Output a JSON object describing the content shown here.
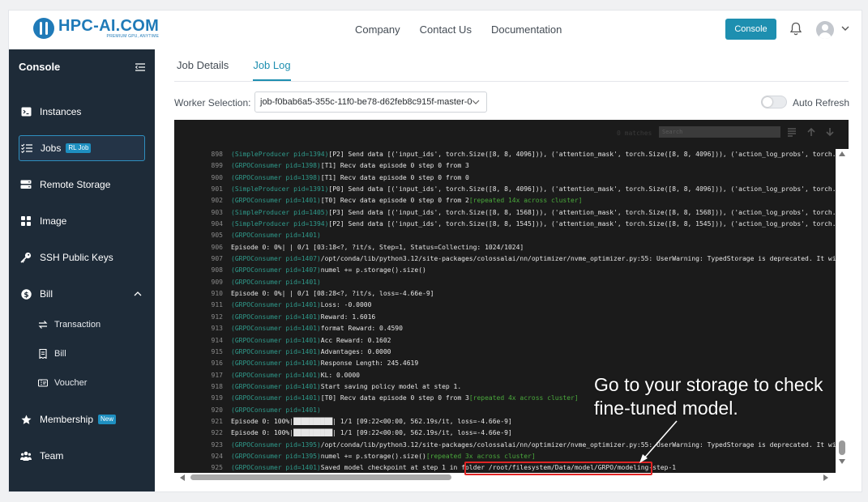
{
  "header": {
    "logo_name": "HPC-AI.COM",
    "logo_tagline": "PREMIUM GPU, ANYTIME",
    "nav": [
      "Company",
      "Contact Us",
      "Documentation"
    ],
    "console_button": "Console"
  },
  "sidebar": {
    "title": "Console",
    "items": [
      {
        "label": "Instances",
        "icon": "terminal-icon"
      },
      {
        "label": "Jobs",
        "icon": "list-check-icon",
        "badge": "RL Job",
        "active": true
      },
      {
        "label": "Remote Storage",
        "icon": "storage-icon"
      },
      {
        "label": "Image",
        "icon": "grid-icon"
      },
      {
        "label": "SSH Public Keys",
        "icon": "key-icon"
      },
      {
        "label": "Bill",
        "icon": "dollar-icon",
        "expanded": true
      },
      {
        "label": "Membership",
        "icon": "star-icon",
        "badge": "New"
      },
      {
        "label": "Team",
        "icon": "team-icon"
      }
    ],
    "bill_children": [
      {
        "label": "Transaction",
        "icon": "swap-icon"
      },
      {
        "label": "Bill",
        "icon": "receipt-icon"
      },
      {
        "label": "Voucher",
        "icon": "voucher-icon"
      }
    ]
  },
  "tabs": [
    {
      "label": "Job Details"
    },
    {
      "label": "Job Log",
      "active": true
    }
  ],
  "worker": {
    "label": "Worker Selection:",
    "value": "job-f0bab6a5-355c-11f0-be78-d62feb8c915f-master-0"
  },
  "auto_refresh": {
    "label": "Auto Refresh",
    "enabled": false
  },
  "log_toolbar": {
    "matches": "0 matches",
    "search_placeholder": "Search"
  },
  "log": [
    {
      "n": "898",
      "pre": "(SimpleProducer pid=1394)",
      "text": " [P2] Send data [('input_ids', torch.Size([8, 8, 4096])), ('attention_mask', torch.Size([8, 8, 4096])), ('action_log_probs', torch.Size([8, 8,",
      "rep": ""
    },
    {
      "n": "899",
      "pre": "(GRPOConsumer pid=1398)",
      "text": " [T1] Recv data episode 0 step 0 from 3",
      "rep": ""
    },
    {
      "n": "900",
      "pre": "(GRPOConsumer pid=1398)",
      "text": " [T1] Recv data episode 0 step 0 from 0",
      "rep": ""
    },
    {
      "n": "901",
      "pre": "(SimpleProducer pid=1391)",
      "text": " [P0] Send data [('input_ids', torch.Size([8, 8, 4096])), ('attention_mask', torch.Size([8, 8, 4096])), ('action_log_probs', torch.Size([8, 8,",
      "rep": ""
    },
    {
      "n": "902",
      "pre": "(GRPOConsumer pid=1401)",
      "text": " [T0] Recv data episode 0 step 0 from 2 ",
      "rep": "[repeated 14x across cluster]"
    },
    {
      "n": "903",
      "pre": "(SimpleProducer pid=1405)",
      "text": " [P3] Send data [('input_ids', torch.Size([8, 8, 1568])), ('attention_mask', torch.Size([8, 8, 1568])), ('action_log_probs', torch.Size([8, 8,",
      "rep": ""
    },
    {
      "n": "904",
      "pre": "(SimpleProducer pid=1394)",
      "text": " [P2] Send data [('input_ids', torch.Size([8, 8, 1545])), ('attention_mask', torch.Size([8, 8, 1545])), ('action_log_probs', torch.Size([8, 8,",
      "rep": ""
    },
    {
      "n": "905",
      "pre": "(GRPOConsumer pid=1401)",
      "text": "",
      "rep": ""
    },
    {
      "n": "906",
      "pre": "",
      "text": "Episode 0:   0%|          | 0/1 [03:18<?, ?it/s, Step=1, Status=Collecting: 1024/1024]",
      "rep": ""
    },
    {
      "n": "907",
      "pre": "(GRPOConsumer pid=1407)",
      "text": " /opt/conda/lib/python3.12/site-packages/colossalai/nn/optimizer/nvme_optimizer.py:55: UserWarning: TypedStorage is deprecated. It will be remov",
      "rep": ""
    },
    {
      "n": "908",
      "pre": "(GRPOConsumer pid=1407)",
      "text": "   numel += p.storage().size()",
      "rep": ""
    },
    {
      "n": "909",
      "pre": "(GRPOConsumer pid=1401)",
      "text": "",
      "rep": ""
    },
    {
      "n": "910",
      "pre": "",
      "text": "Episode 0:   0%|          | 0/1 [08:28<?, ?it/s, loss=-4.66e-9]",
      "rep": ""
    },
    {
      "n": "911",
      "pre": "(GRPOConsumer pid=1401)",
      "text": " Loss: -0.0000",
      "rep": ""
    },
    {
      "n": "912",
      "pre": "(GRPOConsumer pid=1401)",
      "text": " Reward: 1.6016",
      "rep": ""
    },
    {
      "n": "913",
      "pre": "(GRPOConsumer pid=1401)",
      "text": " format Reward: 0.4590",
      "rep": ""
    },
    {
      "n": "914",
      "pre": "(GRPOConsumer pid=1401)",
      "text": " Acc Reward: 0.1602",
      "rep": ""
    },
    {
      "n": "915",
      "pre": "(GRPOConsumer pid=1401)",
      "text": " Advantages: 0.0000",
      "rep": ""
    },
    {
      "n": "916",
      "pre": "(GRPOConsumer pid=1401)",
      "text": " Response Length: 245.4619",
      "rep": ""
    },
    {
      "n": "917",
      "pre": "(GRPOConsumer pid=1401)",
      "text": " KL: 0.0000",
      "rep": ""
    },
    {
      "n": "918",
      "pre": "(GRPOConsumer pid=1401)",
      "text": " Start saving policy model at step 1.",
      "rep": ""
    },
    {
      "n": "919",
      "pre": "(GRPOConsumer pid=1401)",
      "text": " [T0] Recv data episode 0 step 0 from 3 ",
      "rep": "[repeated 4x across cluster]"
    },
    {
      "n": "920",
      "pre": "(GRPOConsumer pid=1401)",
      "text": "",
      "rep": ""
    },
    {
      "n": "921",
      "pre": "",
      "text": "Episode 0: 100%|██████████| 1/1 [09:22<00:00, 562.19s/it, loss=-4.66e-9]",
      "rep": ""
    },
    {
      "n": "922",
      "pre": "",
      "text": "Episode 0: 100%|██████████| 1/1 [09:22<00:00, 562.19s/it, loss=-4.66e-9]",
      "rep": ""
    },
    {
      "n": "923",
      "pre": "(GRPOConsumer pid=1395)",
      "text": " /opt/conda/lib/python3.12/site-packages/colossalai/nn/optimizer/nvme_optimizer.py:55: UserWarning: TypedStorage is deprecated. It will be remov",
      "rep": ""
    },
    {
      "n": "924",
      "pre": "(GRPOConsumer pid=1395)",
      "text": "   numel += p.storage().size() ",
      "rep": "[repeated 3x across cluster]"
    },
    {
      "n": "925",
      "pre": "(GRPOConsumer pid=1401)",
      "text": " Saved model checkpoint at step 1 in folder /root/filesystem/Data/model/GRPO/modeling-step-1",
      "rep": ""
    }
  ],
  "callout": "Go to your storage to check fine-tuned model.",
  "colors": {
    "accent": "#1e8fb0",
    "sidebar_bg": "#1e2b38",
    "highlight": "#e02424"
  }
}
